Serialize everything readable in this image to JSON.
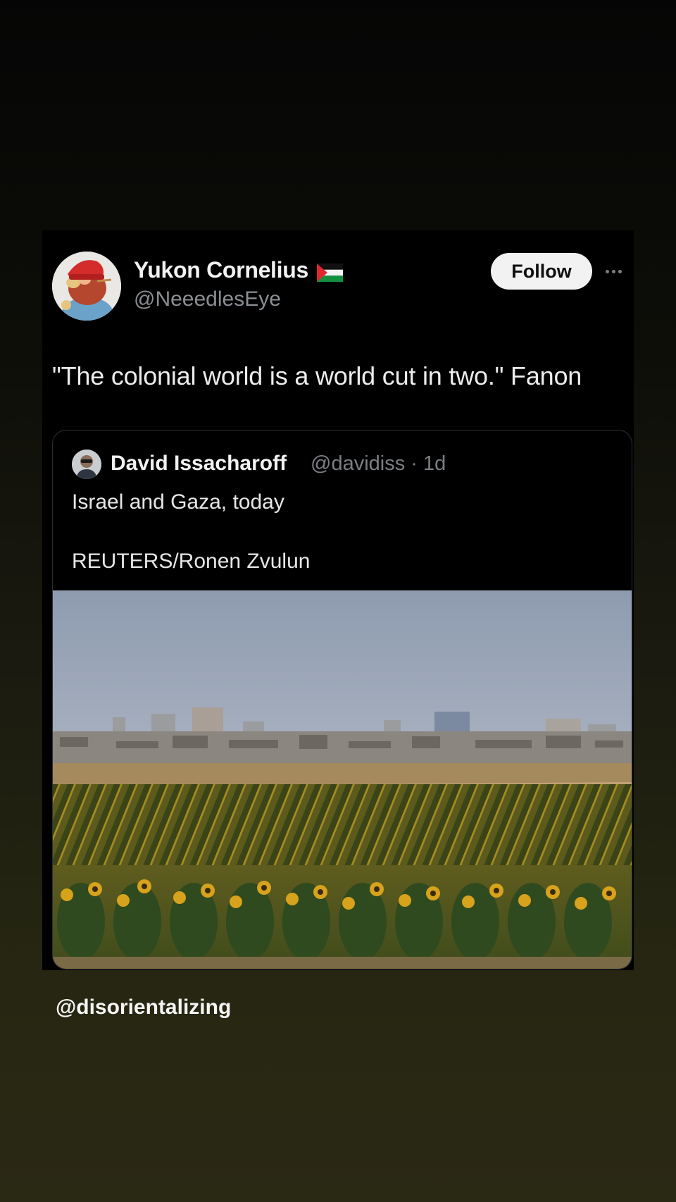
{
  "tweet": {
    "author_name": "Yukon Cornelius",
    "author_handle": "@NeeedlesEye",
    "flag_icon": "palestine-flag-icon",
    "follow_label": "Follow",
    "more_icon": "more-horizontal-icon",
    "text": "\"The colonial world is a world cut in two.\" Fanon"
  },
  "quoted_tweet": {
    "author_name": "David Issacharoff",
    "handle_time": "@davidiss · 1d",
    "text_line_1": "Israel and Gaza, today",
    "text_line_2": "REUTERS/Ronen Zvulun",
    "photo": "photo of sunflower field with ruined city skyline behind"
  },
  "watermark": "@disorientalizing",
  "colors": {
    "background_top": "#050505",
    "background_bottom": "#2a2914",
    "card": "#000000",
    "follow_button": "#f2f2f2",
    "secondary_text": "#8b8f94"
  }
}
